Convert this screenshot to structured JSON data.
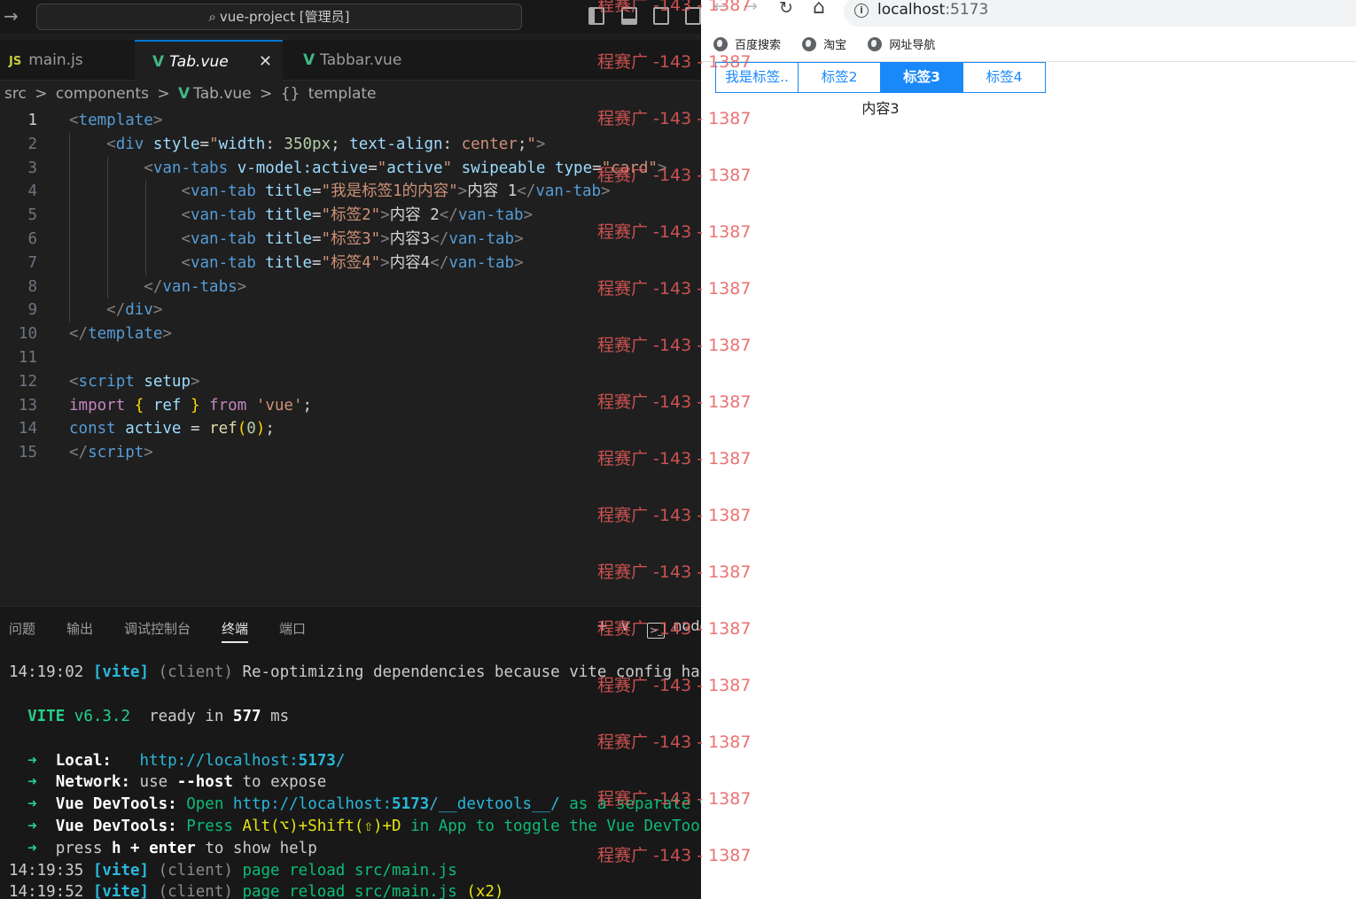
{
  "vscode": {
    "search_title": "vue-project [管理员]",
    "tabs": [
      {
        "label": "main.js",
        "badge": "JS"
      },
      {
        "label": "Tab.vue",
        "badge": "V",
        "close": "✕"
      },
      {
        "label": "Tabbar.vue",
        "badge": "V"
      }
    ],
    "breadcrumb": [
      "src",
      ">",
      "components",
      ">",
      "Tab.vue",
      ">",
      "{}",
      "template"
    ],
    "line_numbers": [
      "1",
      "2",
      "3",
      "4",
      "5",
      "6",
      "7",
      "8",
      "9",
      "10",
      "11",
      "12",
      "13",
      "14",
      "15"
    ],
    "panel_tabs": [
      "问题",
      "输出",
      "调试控制台",
      "终端",
      "端口"
    ],
    "panel_actions": {
      "add": "+",
      "chevron": "∨",
      "terminal_name": "node"
    },
    "terminal": {
      "l1_time": "14:19:02",
      "l1_vite": "[vite]",
      "l1_client": "(client)",
      "l1_msg": "Re-optimizing dependencies because vite config has c",
      "vite_name": "VITE",
      "vite_version": "v6.3.2",
      "ready": "ready in",
      "ready_ms": "577",
      "ms": "ms",
      "local_label": "Local:",
      "local_url_a": "http://localhost:",
      "local_url_port": "5173",
      "local_url_b": "/",
      "network_label": "Network:",
      "network_msg_a": "use",
      "network_flag": "--host",
      "network_msg_b": "to expose",
      "devtools_label": "Vue DevTools:",
      "devtools1_a": "Open",
      "devtools1_url_a": "http://localhost:",
      "devtools1_port": "5173",
      "devtools1_url_b": "/__devtools__/",
      "devtools1_b": "as a separate win",
      "devtools2_a": "Press",
      "devtools2_keys": "Alt(⌥)+Shift(⇧)+D",
      "devtools2_b": "in App to toggle the Vue DevTools",
      "help_a": "press",
      "help_h": "h + enter",
      "help_b": "to show help",
      "r1_time": "14:19:35",
      "r2_time": "14:19:52",
      "reload_msg": "page reload src/main.js",
      "reload_x2": "(x2)"
    }
  },
  "browser": {
    "nav": {
      "back": "←",
      "forward": "→",
      "reload": "↻",
      "home": "⌂"
    },
    "address_host": "localhost",
    "address_port": ":5173",
    "info_icon": "i",
    "bookmarks": [
      "百度搜索",
      "淘宝",
      "网址导航"
    ],
    "van_tabs": [
      {
        "label": "我是标签..",
        "active": false
      },
      {
        "label": "标签2",
        "active": false
      },
      {
        "label": "标签3",
        "active": true
      },
      {
        "label": "标签4",
        "active": false
      }
    ],
    "content": "内容3"
  },
  "watermark_text": "程赛广 -143 - 1387"
}
